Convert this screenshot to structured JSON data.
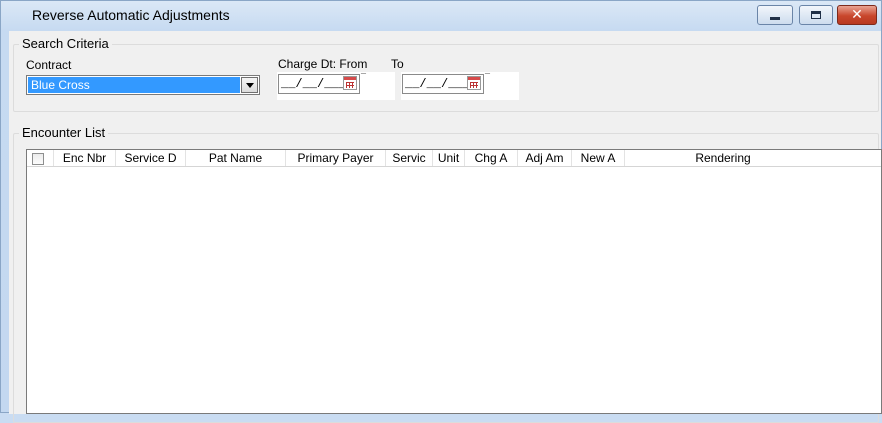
{
  "window": {
    "title": "Reverse Automatic Adjustments",
    "close_glyph": "✕"
  },
  "search": {
    "group_label": "Search Criteria",
    "contract_label": "Contract",
    "contract_value": "Blue Cross",
    "charge_from_label": "Charge Dt: From",
    "to_label": "To",
    "date_from": "__/__/____",
    "date_to": "__/__/____"
  },
  "encounters": {
    "group_label": "Encounter List",
    "columns": [
      "Enc Nbr",
      "Service D",
      "Pat Name",
      "Primary Payer",
      "Servic",
      "Unit",
      "Chg A",
      "Adj Am",
      "New A",
      "Rendering"
    ]
  },
  "icons": {
    "minimize": "minimize-icon",
    "maximize": "maximize-icon",
    "close": "close-icon",
    "dropdown": "chevron-down-icon",
    "calendar": "calendar-icon"
  },
  "colors": {
    "selection": "#3399ff",
    "close_button": "#c8462c",
    "titlebar": "#c6daf1"
  }
}
